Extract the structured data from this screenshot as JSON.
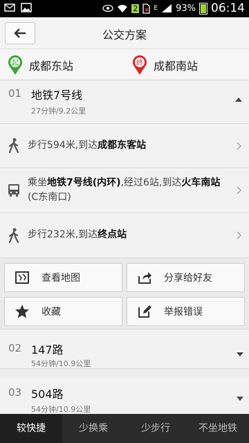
{
  "status_bar": {
    "battery": "93%",
    "time": "06:14",
    "sim_badge": "2",
    "network_badge": "E"
  },
  "header": {
    "title": "公交方案"
  },
  "stations": {
    "start_badge": "起",
    "start": "成都东站",
    "end_badge": "终",
    "end": "成都南站"
  },
  "selected_route": {
    "index": "01",
    "name": "地铁7号线",
    "meta": "27分钟/9.2公里",
    "steps": [
      {
        "icon": "walk-icon",
        "text_prefix": "步行594米,到达",
        "text_bold": "成都东客站"
      },
      {
        "icon": "bus-icon",
        "text_prefix": "乘坐",
        "line": "地铁7号线(内环)",
        "text_mid": ",经过6站,到达",
        "stop": "火车南站",
        "text_suffix": "(C东南口)"
      },
      {
        "icon": "walk-icon",
        "text_prefix": "步行232米,到达",
        "text_bold": "终点站"
      }
    ]
  },
  "actions": [
    {
      "icon": "map-icon",
      "label": "查看地图"
    },
    {
      "icon": "share-icon",
      "label": "分享给好友"
    },
    {
      "icon": "star-icon",
      "label": "收藏"
    },
    {
      "icon": "edit-icon",
      "label": "举报错误"
    }
  ],
  "other_routes": [
    {
      "index": "02",
      "name": "147路",
      "meta": "54分钟/10.9公里"
    },
    {
      "index": "03",
      "name": "504路",
      "meta": "54分钟/10.9公里"
    }
  ],
  "tabs": [
    {
      "label": "较快捷",
      "active": true
    },
    {
      "label": "少换乘",
      "active": false
    },
    {
      "label": "少步行",
      "active": false
    },
    {
      "label": "不坐地铁",
      "active": false
    }
  ],
  "colors": {
    "start_pin": "#3aa53a",
    "end_pin": "#d9262b",
    "tab_bg": "#2b2b2b",
    "battery": "#9bd33b"
  }
}
